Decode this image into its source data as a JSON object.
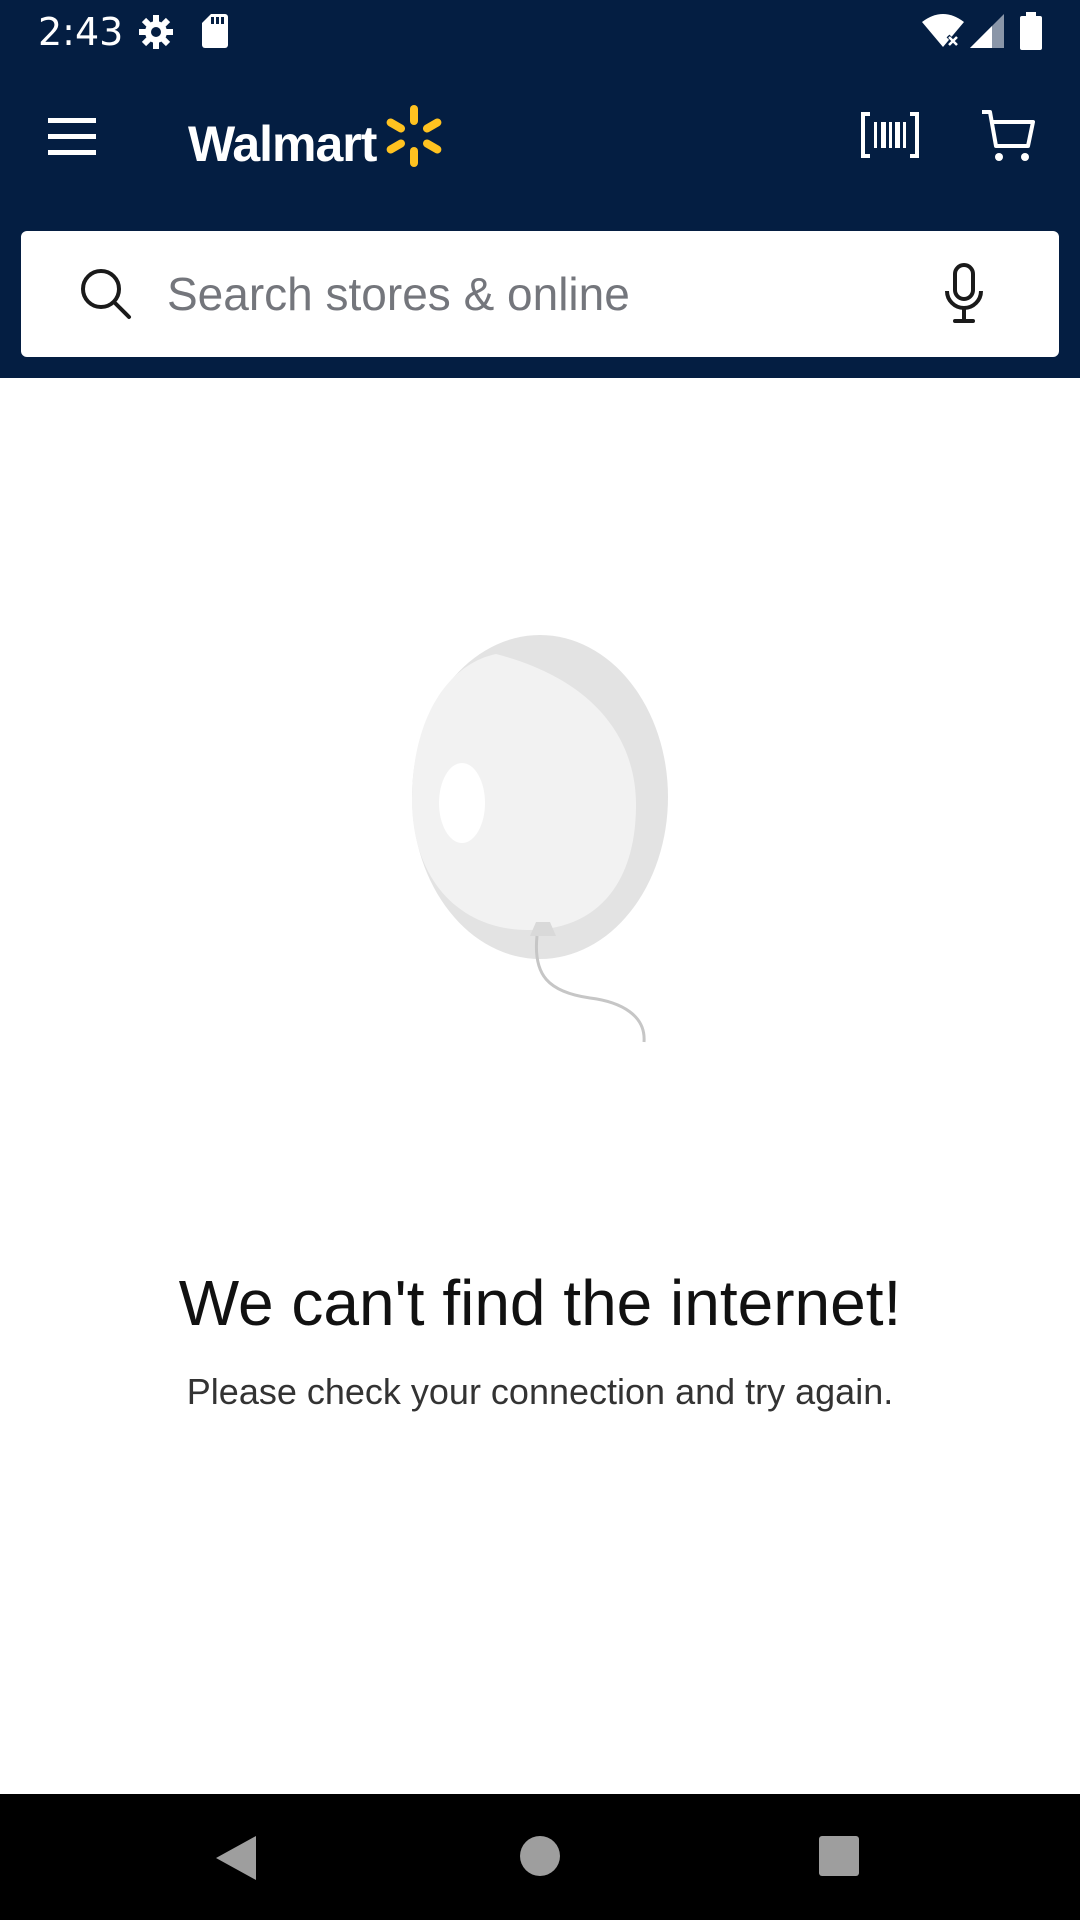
{
  "status_bar": {
    "time": "2:43",
    "icons": [
      "settings-icon",
      "sd-card-icon",
      "wifi-off-icon",
      "cell-signal-icon",
      "battery-icon"
    ]
  },
  "header": {
    "menu_icon": "hamburger-menu-icon",
    "brand": "Walmart",
    "brand_logo_icon": "spark-logo-icon",
    "scan_icon": "barcode-scanner-icon",
    "cart_icon": "cart-icon",
    "colors": {
      "header_bg": "#041e42",
      "spark": "#ffc220"
    }
  },
  "search": {
    "placeholder": "Search stores & online",
    "value": "",
    "search_icon": "search-icon",
    "mic_icon": "microphone-icon"
  },
  "error": {
    "illustration_icon": "balloon-illustration",
    "title": "We can't find the internet!",
    "message": "Please check your connection and try again."
  },
  "nav_bar": {
    "buttons": [
      "back-icon",
      "home-icon",
      "recents-icon"
    ]
  }
}
